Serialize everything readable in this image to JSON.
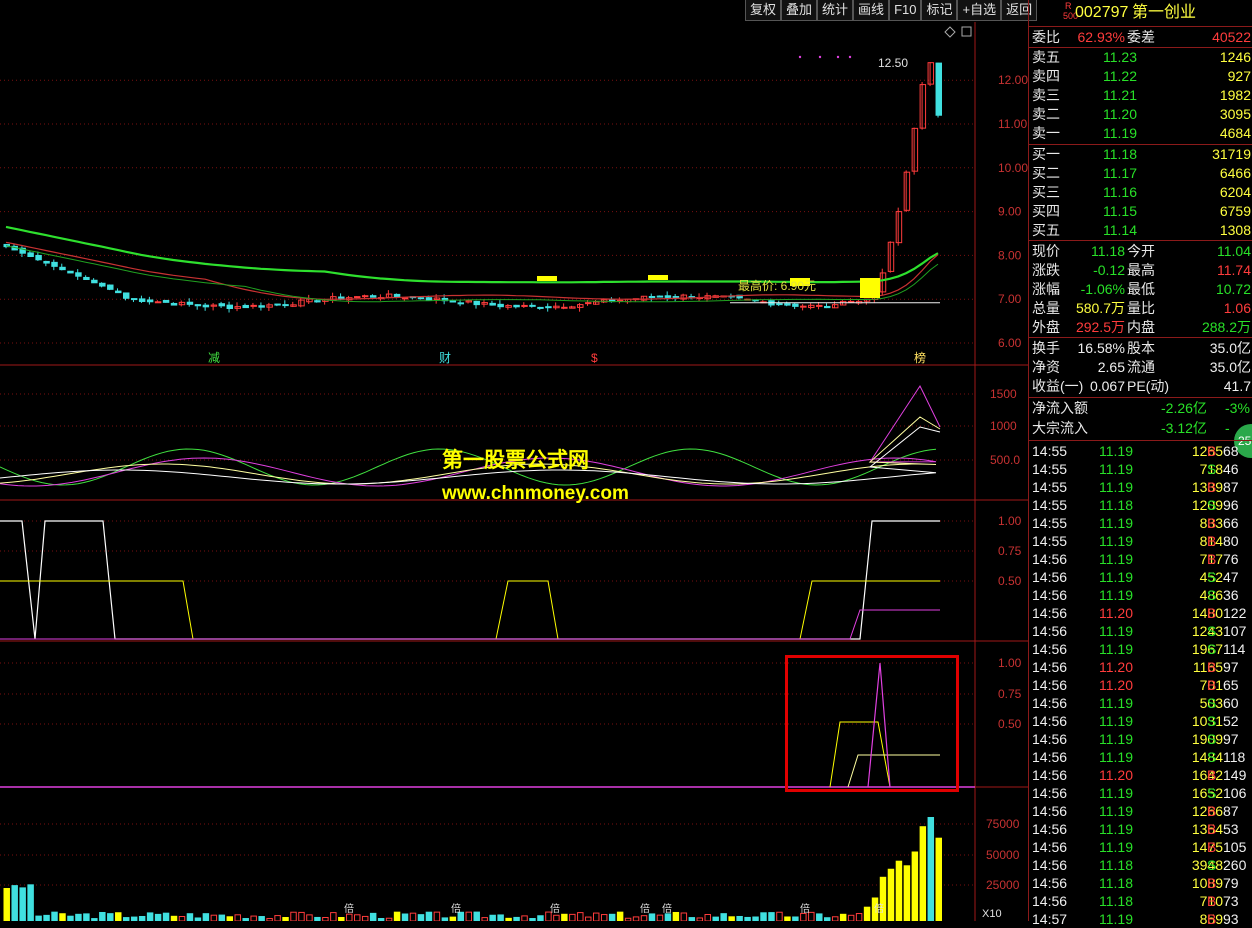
{
  "toolbar": {
    "items": [
      "复权",
      "叠加",
      "统计",
      "画线",
      "F10",
      "标记",
      "+自选",
      "返回"
    ]
  },
  "stock": {
    "code": "002797",
    "name": "第一创业",
    "badge_top": "R",
    "badge_bottom": "500"
  },
  "ratio": {
    "label1": "委比",
    "val1": "62.93%",
    "label2": "委差",
    "val2": "40522"
  },
  "asks": [
    {
      "label": "卖五",
      "price": "11.23",
      "vol": "1246"
    },
    {
      "label": "卖四",
      "price": "11.22",
      "vol": "927"
    },
    {
      "label": "卖三",
      "price": "11.21",
      "vol": "1982"
    },
    {
      "label": "卖二",
      "price": "11.20",
      "vol": "3095"
    },
    {
      "label": "卖一",
      "price": "11.19",
      "vol": "4684"
    }
  ],
  "bids": [
    {
      "label": "买一",
      "price": "11.18",
      "vol": "31719"
    },
    {
      "label": "买二",
      "price": "11.17",
      "vol": "6466"
    },
    {
      "label": "买三",
      "price": "11.16",
      "vol": "6204"
    },
    {
      "label": "买四",
      "price": "11.15",
      "vol": "6759"
    },
    {
      "label": "买五",
      "price": "11.14",
      "vol": "1308"
    }
  ],
  "quote": [
    {
      "l1": "现价",
      "v1": "11.18",
      "l2": "今开",
      "v2": "11.04"
    },
    {
      "l1": "涨跌",
      "v1": "-0.12",
      "l2": "最高",
      "v2": "11.74"
    },
    {
      "l1": "涨幅",
      "v1": "-1.06%",
      "l2": "最低",
      "v2": "10.72"
    },
    {
      "l1": "总量",
      "v1": "580.7万",
      "l2": "量比",
      "v2": "1.06"
    },
    {
      "l1": "外盘",
      "v1": "292.5万",
      "l2": "内盘",
      "v2": "288.2万"
    }
  ],
  "fundamentals": [
    {
      "l1": "换手",
      "v1": "16.58%",
      "l2": "股本",
      "v2": "35.0亿"
    },
    {
      "l1": "净资",
      "v1": "2.65",
      "l2": "流通",
      "v2": "35.0亿"
    },
    {
      "l1": "收益(一)",
      "v1": "0.067",
      "l2": "PE(动)",
      "v2": "41.7"
    }
  ],
  "flows": [
    {
      "label": "净流入额",
      "value": "-2.26亿",
      "pct": "-3%"
    },
    {
      "label": "大宗流入",
      "value": "-3.12亿",
      "pct": "-"
    }
  ],
  "badge_circle": "25",
  "trades": [
    {
      "t": "14:55",
      "p": "11.19",
      "v": "1265",
      "s": "B",
      "n": "68"
    },
    {
      "t": "14:55",
      "p": "11.19",
      "v": "718",
      "s": "S",
      "n": "46"
    },
    {
      "t": "14:55",
      "p": "11.19",
      "v": "1339",
      "s": "B",
      "n": "87"
    },
    {
      "t": "14:55",
      "p": "11.18",
      "v": "1209",
      "s": "S",
      "n": "96"
    },
    {
      "t": "14:55",
      "p": "11.19",
      "v": "833",
      "s": "B",
      "n": "66"
    },
    {
      "t": "14:55",
      "p": "11.19",
      "v": "814",
      "s": "B",
      "n": "80"
    },
    {
      "t": "14:56",
      "p": "11.19",
      "v": "717",
      "s": "B",
      "n": "76"
    },
    {
      "t": "14:56",
      "p": "11.19",
      "v": "452",
      "s": "S",
      "n": "47"
    },
    {
      "t": "14:56",
      "p": "11.19",
      "v": "486",
      "s": "S",
      "n": "36"
    },
    {
      "t": "14:56",
      "p": "11.20",
      "v": "1480",
      "s": "B",
      "n": "122"
    },
    {
      "t": "14:56",
      "p": "11.19",
      "v": "1243",
      "s": "S",
      "n": "107"
    },
    {
      "t": "14:56",
      "p": "11.19",
      "v": "1967",
      "s": "S",
      "n": "114"
    },
    {
      "t": "14:56",
      "p": "11.20",
      "v": "1165",
      "s": "B",
      "n": "97"
    },
    {
      "t": "14:56",
      "p": "11.20",
      "v": "701",
      "s": "B",
      "n": "65"
    },
    {
      "t": "14:56",
      "p": "11.19",
      "v": "503",
      "s": "S",
      "n": "60"
    },
    {
      "t": "14:56",
      "p": "11.19",
      "v": "1031",
      "s": "S",
      "n": "52"
    },
    {
      "t": "14:56",
      "p": "11.19",
      "v": "1909",
      "s": "S",
      "n": "97"
    },
    {
      "t": "14:56",
      "p": "11.19",
      "v": "1484",
      "s": "S",
      "n": "118"
    },
    {
      "t": "14:56",
      "p": "11.20",
      "v": "1642",
      "s": "B",
      "n": "149"
    },
    {
      "t": "14:56",
      "p": "11.19",
      "v": "1652",
      "s": "S",
      "n": "106"
    },
    {
      "t": "14:56",
      "p": "11.19",
      "v": "1266",
      "s": "B",
      "n": "87"
    },
    {
      "t": "14:56",
      "p": "11.19",
      "v": "1354",
      "s": "B",
      "n": "53"
    },
    {
      "t": "14:56",
      "p": "11.19",
      "v": "1475",
      "s": "B",
      "n": "105"
    },
    {
      "t": "14:56",
      "p": "11.18",
      "v": "3948",
      "s": "S",
      "n": "260"
    },
    {
      "t": "14:56",
      "p": "11.18",
      "v": "1089",
      "s": "B",
      "n": "79"
    },
    {
      "t": "14:56",
      "p": "11.18",
      "v": "710",
      "s": "B",
      "n": "73"
    },
    {
      "t": "14:57",
      "p": "11.19",
      "v": "859",
      "s": "B",
      "n": "93"
    }
  ],
  "chart": {
    "price_ticks": [
      "12.00",
      "11.00",
      "10.00",
      "9.00",
      "8.00",
      "7.00",
      "6.00"
    ],
    "ind1_ticks": [
      "1500",
      "1000",
      "500.0"
    ],
    "ind2_ticks": [
      "1.00",
      "0.75",
      "0.50"
    ],
    "ind3_ticks": [
      "1.00",
      "0.75",
      "0.50"
    ],
    "vol_ticks": [
      "75000",
      "50000",
      "25000"
    ],
    "vol_unit": "X10",
    "max_price_label": "最高价: 6.90元",
    "top_marker": "12.50",
    "event_markers": [
      "减",
      "财",
      "$",
      "榜"
    ],
    "vol_marks": [
      "倍",
      "倍",
      "倍",
      "倍",
      "倍",
      "倍",
      "倍"
    ]
  },
  "watermark": {
    "line1": "第一股票公式网",
    "line2": "www.chnmoney.com"
  },
  "colors": {
    "up": "#ff3c3c",
    "down": "#40e0e0",
    "ma_green": "#2ee02e",
    "ma_red": "#c83232",
    "grid": "#7a1010",
    "yellow": "#ffff00",
    "magenta": "#e040e0"
  }
}
